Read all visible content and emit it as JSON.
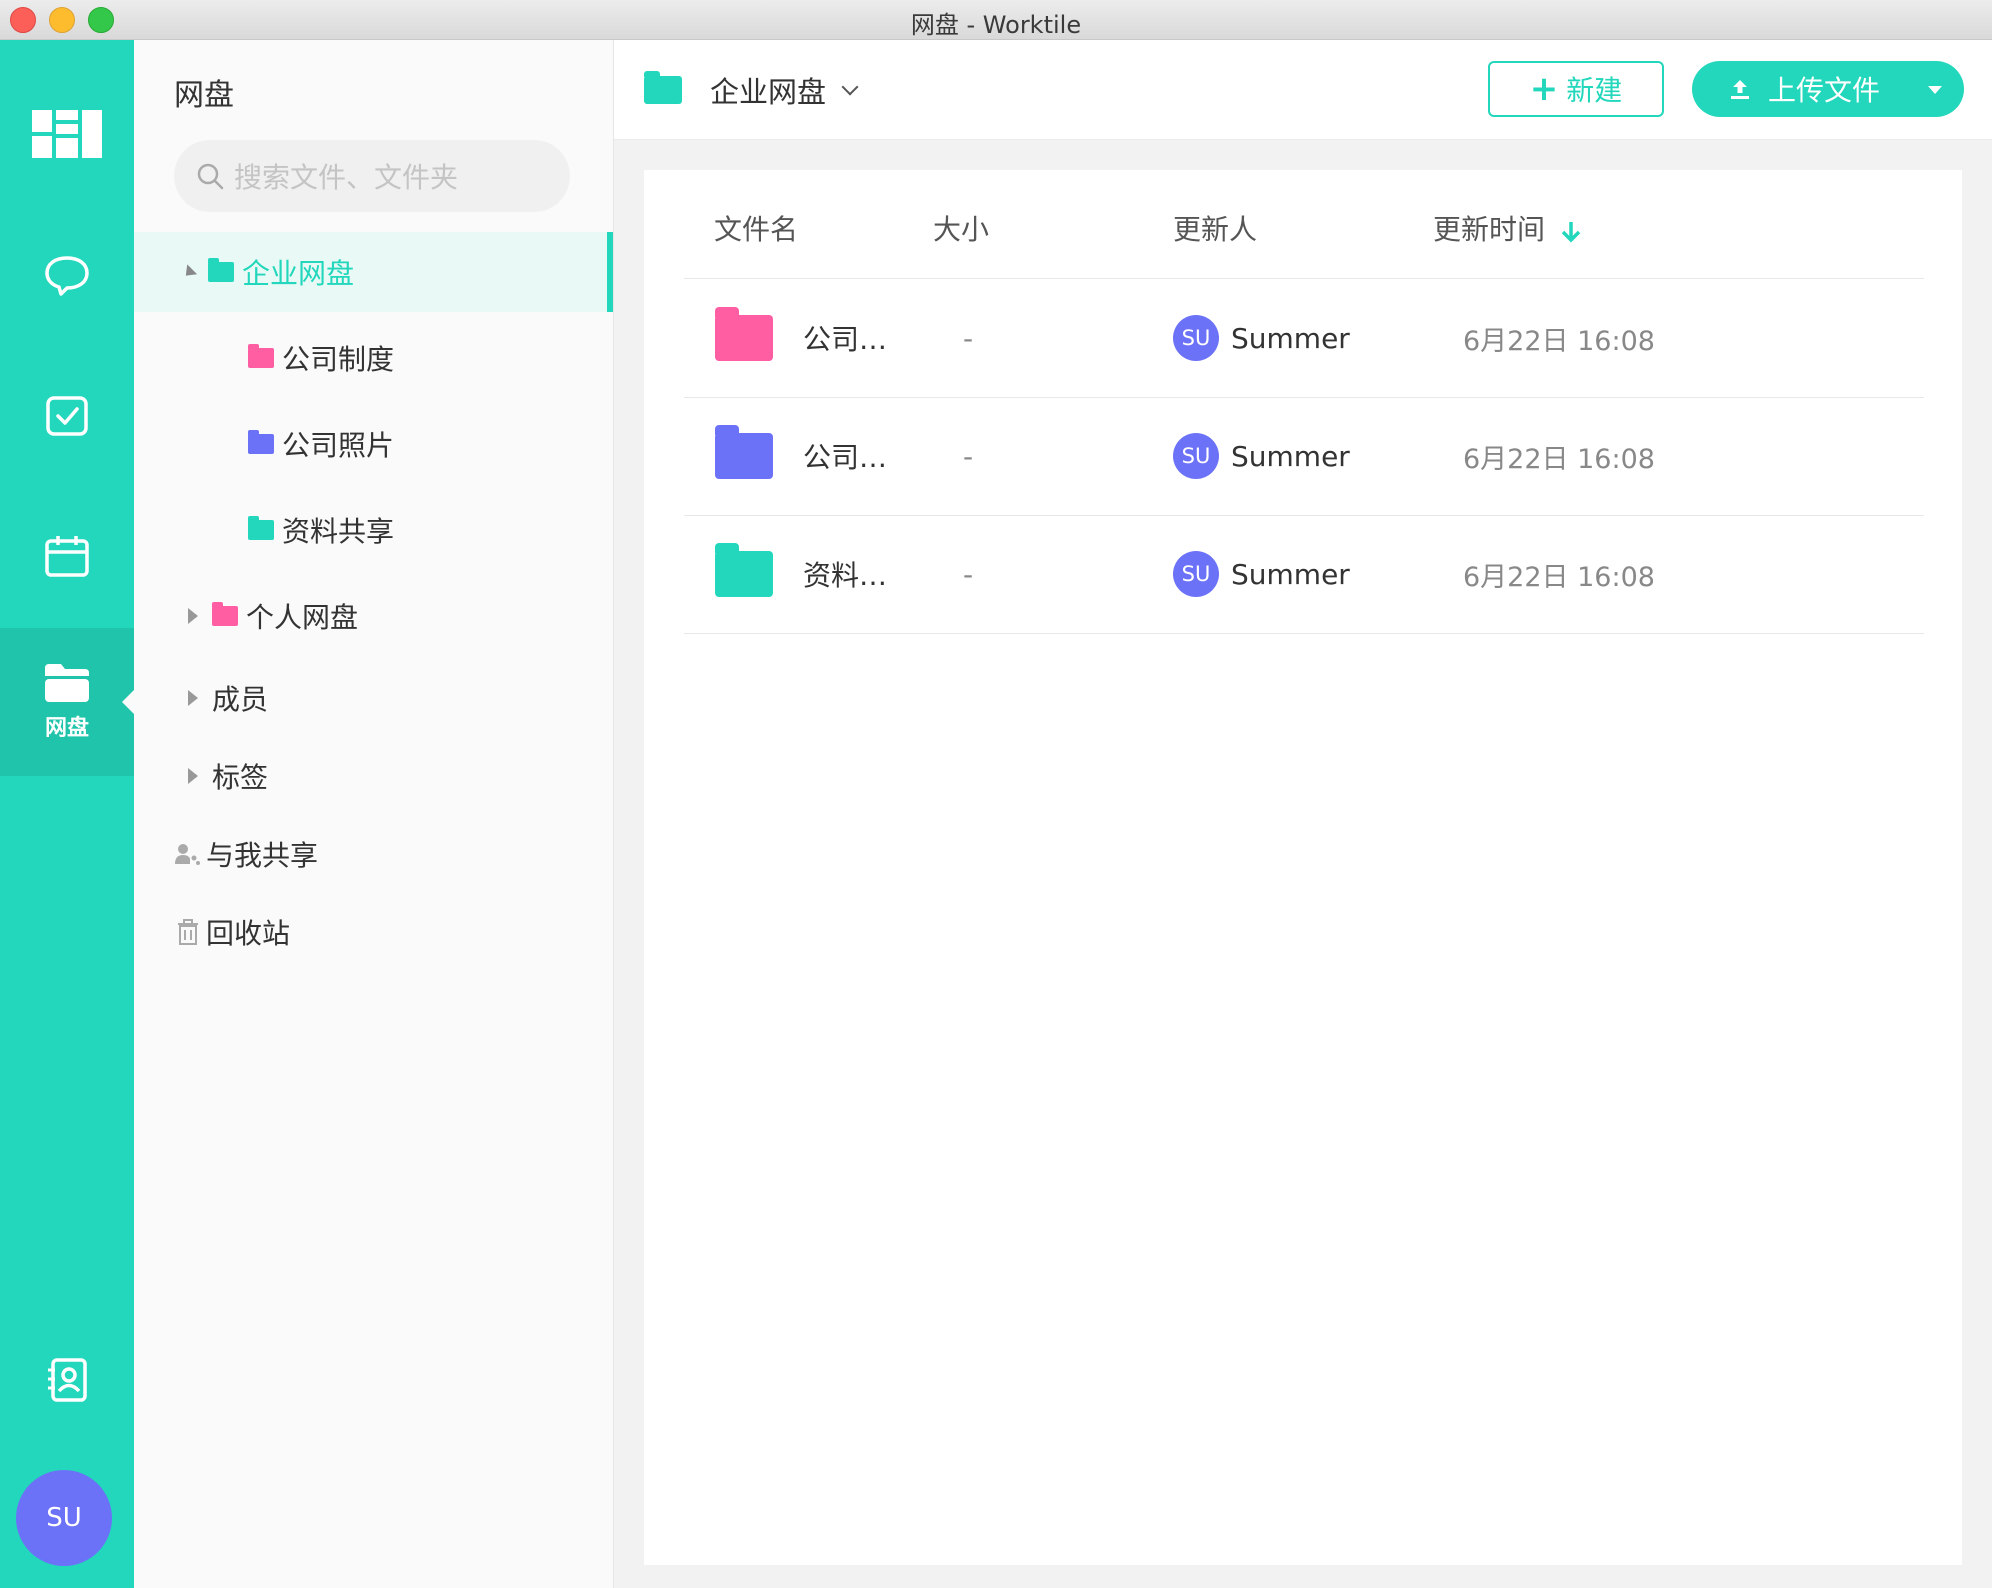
{
  "window": {
    "title": "网盘 - Worktile"
  },
  "rail": {
    "items": [
      {
        "icon": "dashboard-icon"
      },
      {
        "icon": "chat-icon"
      },
      {
        "icon": "task-check-icon"
      },
      {
        "icon": "calendar-icon"
      },
      {
        "icon": "folder-icon",
        "label": "网盘",
        "active": true
      },
      {
        "icon": "contacts-icon"
      }
    ],
    "avatar": "SU"
  },
  "sidebar": {
    "title": "网盘",
    "search_placeholder": "搜索文件、文件夹",
    "tree": [
      {
        "label": "企业网盘",
        "selected": true,
        "color": "#22d7bb"
      },
      {
        "label": "公司制度",
        "color": "#ff5fa2"
      },
      {
        "label": "公司照片",
        "color": "#6c72f7"
      },
      {
        "label": "资料共享",
        "color": "#22d7bb"
      },
      {
        "label": "个人网盘",
        "color": "#ff5fa2"
      },
      {
        "label": "成员"
      },
      {
        "label": "标签"
      },
      {
        "label": "与我共享"
      },
      {
        "label": "回收站"
      }
    ]
  },
  "header": {
    "breadcrumb": "企业网盘",
    "new_label": "新建",
    "upload_label": "上传文件"
  },
  "table": {
    "columns": [
      "文件名",
      "大小",
      "更新人",
      "更新时间"
    ],
    "rows": [
      {
        "name": "公司…",
        "size": "-",
        "avatar": "SU",
        "user": "Summer",
        "time": "6月22日 16:08",
        "color": "#ff5fa2"
      },
      {
        "name": "公司…",
        "size": "-",
        "avatar": "SU",
        "user": "Summer",
        "time": "6月22日 16:08",
        "color": "#6c72f7"
      },
      {
        "name": "资料…",
        "size": "-",
        "avatar": "SU",
        "user": "Summer",
        "time": "6月22日 16:08",
        "color": "#22d7bb"
      }
    ]
  },
  "colors": {
    "accent": "#22d7bb",
    "pink": "#ff5fa2",
    "purple": "#6c72f7"
  }
}
